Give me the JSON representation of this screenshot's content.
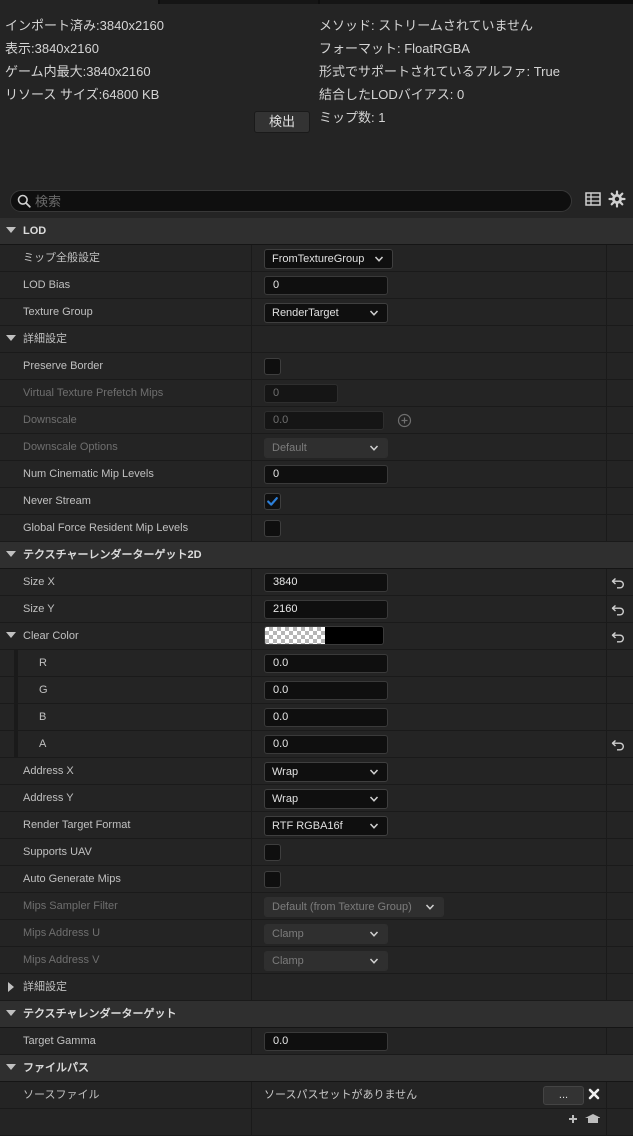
{
  "info": {
    "left_lines": [
      "インポート済み:3840x2160",
      "表示:3840x2160",
      "ゲーム内最大:3840x2160",
      "リソース サイズ:64800 KB"
    ],
    "right_lines": [
      "メソッド: ストリームされていません",
      "フォーマット: FloatRGBA",
      "形式でサポートされているアルファ: True",
      "結合したLODバイアス: 0",
      "ミップ数: 1"
    ],
    "detect_label": "検出"
  },
  "search": {
    "placeholder": "検索",
    "value": ""
  },
  "rows": [
    {
      "type": "cat",
      "label": "LOD",
      "expanded": true
    },
    {
      "type": "combo",
      "label": "ミップ全般設定",
      "value": "FromTextureGroup"
    },
    {
      "type": "field",
      "label": "LOD Bias",
      "value": "0"
    },
    {
      "type": "combo",
      "label": "Texture Group",
      "value": "RenderTarget"
    },
    {
      "type": "subcat",
      "label": "詳細設定",
      "expanded": true
    },
    {
      "type": "check",
      "label": "Preserve Border",
      "checked": false
    },
    {
      "type": "field",
      "label": "Virtual Texture Prefetch Mips",
      "value": "0",
      "disabled": true
    },
    {
      "type": "field",
      "label": "Downscale",
      "value": "0.0",
      "disabled": true,
      "extra": "plus"
    },
    {
      "type": "combo",
      "label": "Downscale Options",
      "value": "Default",
      "disabled": true
    },
    {
      "type": "field",
      "label": "Num Cinematic Mip Levels",
      "value": "0"
    },
    {
      "type": "check",
      "label": "Never Stream",
      "checked": true
    },
    {
      "type": "check",
      "label": "Global Force Resident Mip Levels",
      "checked": false
    },
    {
      "type": "cat",
      "label": "テクスチャーレンダーターゲット2D",
      "expanded": true
    },
    {
      "type": "field",
      "label": "Size X",
      "value": "3840",
      "reset": true
    },
    {
      "type": "field",
      "label": "Size Y",
      "value": "2160",
      "reset": true
    },
    {
      "type": "color",
      "label": "Clear Color",
      "expanded": true,
      "reset": true
    },
    {
      "type": "field",
      "label": "R",
      "value": "0.0",
      "child": true
    },
    {
      "type": "field",
      "label": "G",
      "value": "0.0",
      "child": true
    },
    {
      "type": "field",
      "label": "B",
      "value": "0.0",
      "child": true
    },
    {
      "type": "field",
      "label": "A",
      "value": "0.0",
      "child": true,
      "reset": true
    },
    {
      "type": "combo",
      "label": "Address X",
      "value": "Wrap"
    },
    {
      "type": "combo",
      "label": "Address Y",
      "value": "Wrap"
    },
    {
      "type": "combo",
      "label": "Render Target Format",
      "value": "RTF RGBA16f"
    },
    {
      "type": "check",
      "label": "Supports UAV",
      "checked": false
    },
    {
      "type": "check",
      "label": "Auto Generate Mips",
      "checked": false
    },
    {
      "type": "combo",
      "label": "Mips Sampler Filter",
      "value": "Default (from Texture Group)",
      "disabled": true
    },
    {
      "type": "combo",
      "label": "Mips Address U",
      "value": "Clamp",
      "disabled": true
    },
    {
      "type": "combo",
      "label": "Mips Address V",
      "value": "Clamp",
      "disabled": true
    },
    {
      "type": "subcat",
      "label": "詳細設定",
      "expanded": false
    },
    {
      "type": "cat",
      "label": "テクスチャレンダーターゲット",
      "expanded": true
    },
    {
      "type": "field",
      "label": "Target Gamma",
      "value": "0.0"
    },
    {
      "type": "cat",
      "label": "ファイルパス",
      "expanded": true
    },
    {
      "type": "file",
      "label": "ソースファイル",
      "value": "ソースパスセットがありません",
      "button": "..."
    },
    {
      "type": "blank",
      "label": ""
    }
  ],
  "colors": {
    "accent": "#2c7fd9",
    "panel": "#242424",
    "category": "#2f2f2f",
    "field": "#0f0f0f",
    "text": "#c0c0c0",
    "disabled_text": "#6f6f6f"
  }
}
